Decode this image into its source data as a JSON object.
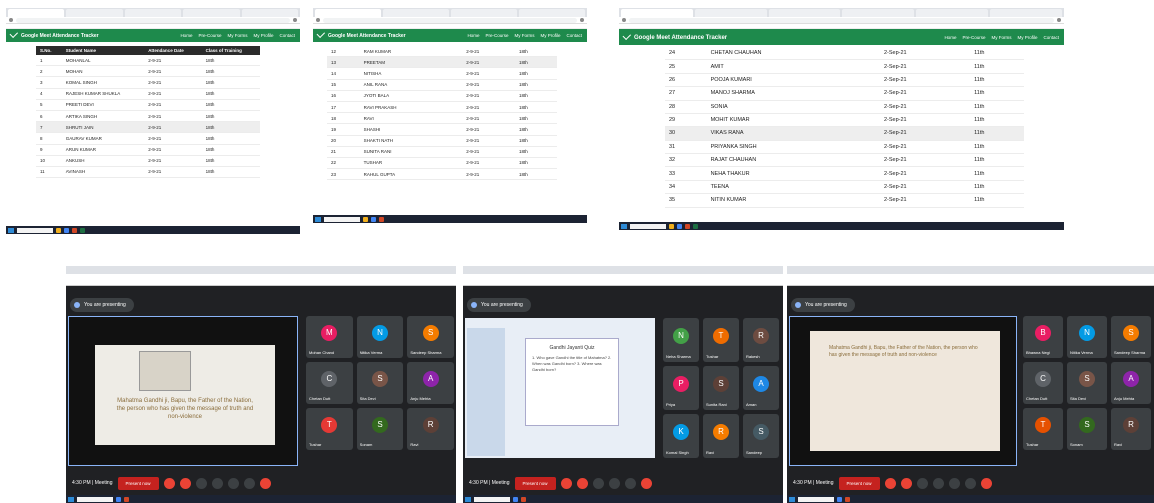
{
  "app_title": "Google Meet Attendance Tracker",
  "nav": [
    "Home",
    "Pre-Course",
    "My Forms",
    "My Profile",
    "Contact"
  ],
  "table_headers": [
    "S.No.",
    "Student Name",
    "Attendance Date",
    "Class of Training"
  ],
  "screens": [
    {
      "rows": [
        [
          "1",
          "MOHANLAL",
          "2-9-21",
          "18th"
        ],
        [
          "2",
          "MOHAN",
          "2-9-21",
          "18th"
        ],
        [
          "3",
          "KOMAL SINGH",
          "2-9-21",
          "18th"
        ],
        [
          "4",
          "RAJESH KUMAR SHUKLA",
          "2-9-21",
          "18th"
        ],
        [
          "5",
          "PREETI DEVI",
          "2-9-21",
          "18th"
        ],
        [
          "6",
          "ARTIKA SINGH",
          "2-9-21",
          "18th"
        ],
        [
          "7",
          "SHRUTI JAIN",
          "2-9-21",
          "18th"
        ],
        [
          "8",
          "GAURAV KUMAR",
          "2-9-21",
          "18th"
        ],
        [
          "9",
          "ARUN KUMAR",
          "2-9-21",
          "18th"
        ],
        [
          "10",
          "ANKUSH",
          "2-9-21",
          "18th"
        ],
        [
          "11",
          "AVINASH",
          "2-9-21",
          "18th"
        ]
      ]
    },
    {
      "rows": [
        [
          "12",
          "RAM KUMAR",
          "2-9-21",
          "18th"
        ],
        [
          "13",
          "PREETAM",
          "2-9-21",
          "18th"
        ],
        [
          "14",
          "NITISHA",
          "2-9-21",
          "18th"
        ],
        [
          "15",
          "ANIL RANA",
          "2-9-21",
          "18th"
        ],
        [
          "16",
          "JYOTI BALA",
          "2-9-21",
          "18th"
        ],
        [
          "17",
          "RAVI PRAKASH",
          "2-9-21",
          "18th"
        ],
        [
          "18",
          "RAVI",
          "2-9-21",
          "18th"
        ],
        [
          "19",
          "SHASHI",
          "2-9-21",
          "18th"
        ],
        [
          "20",
          "SHAKTI NATH",
          "2-9-21",
          "18th"
        ],
        [
          "21",
          "SUNITA RANI",
          "2-9-21",
          "18th"
        ],
        [
          "22",
          "TUSHAR",
          "2-9-21",
          "18th"
        ],
        [
          "23",
          "RAHUL GUPTA",
          "2-9-21",
          "18th"
        ]
      ]
    },
    {
      "rows": [
        [
          "24",
          "CHETAN CHAUHAN",
          "2-Sep-21",
          "11th"
        ],
        [
          "25",
          "AMIT",
          "2-Sep-21",
          "11th"
        ],
        [
          "26",
          "POOJA KUMARI",
          "2-Sep-21",
          "11th"
        ],
        [
          "27",
          "MANOJ SHARMA",
          "2-Sep-21",
          "11th"
        ],
        [
          "28",
          "SONIA",
          "2-Sep-21",
          "11th"
        ],
        [
          "29",
          "MOHIT KUMAR",
          "2-Sep-21",
          "11th"
        ],
        [
          "30",
          "VIKAS RANA",
          "2-Sep-21",
          "11th"
        ],
        [
          "31",
          "PRIYANKA SINGH",
          "2-Sep-21",
          "11th"
        ],
        [
          "32",
          "RAJAT CHAUHAN",
          "2-Sep-21",
          "11th"
        ],
        [
          "33",
          "NEHA THAKUR",
          "2-Sep-21",
          "11th"
        ],
        [
          "34",
          "TEENA",
          "2-Sep-21",
          "11th"
        ],
        [
          "35",
          "NITIN KUMAR",
          "2-Sep-21",
          "11th"
        ]
      ]
    }
  ],
  "meet": {
    "presenting_1": "You are presenting",
    "presenting_2": "You are presenting",
    "presenting_3": "You are presenting",
    "present_now": "Present now",
    "time_1": "4:30 PM | Meeting",
    "time_2": "4:30 PM | Meeting",
    "time_3": "4:30 PM | Meeting",
    "slide_caption": "Mahatma Gandhi ji, Bapu, the Father of the Nation, the person who has given the message of truth and non-violence",
    "ppt_title": "Gandhi Jayanti Quiz",
    "ppt_body": "1. Who gave Gandhi the title of Mahatma? 2. When was Gandhi born? 3. Where was Gandhi born?",
    "tiles_a": [
      "Mohan Chand",
      "Nitika Verma",
      "Sandeep Sharma",
      "Chetan Dutt",
      "Sita Devi",
      "Anju Mehta",
      "Tushar",
      "Sonam",
      "Ravi"
    ],
    "tiles_b": [
      "Neha Sharma",
      "Tushar",
      "Rakesh",
      "Priya",
      "Sunita Rani",
      "Aman",
      "Komal Singh",
      "Ravi",
      "Sandeep"
    ],
    "tiles_c": [
      "Bhawna Negi",
      "Nitika Verma",
      "Sandeep Sharma",
      "Chetan Dutt",
      "Sita Devi",
      "Anju Mehta",
      "Tushar",
      "Sonam",
      "Ravi"
    ]
  },
  "colors": {
    "header_green": "#1e8a4c",
    "meet_bg": "#202124",
    "end_call": "#ea4335"
  }
}
